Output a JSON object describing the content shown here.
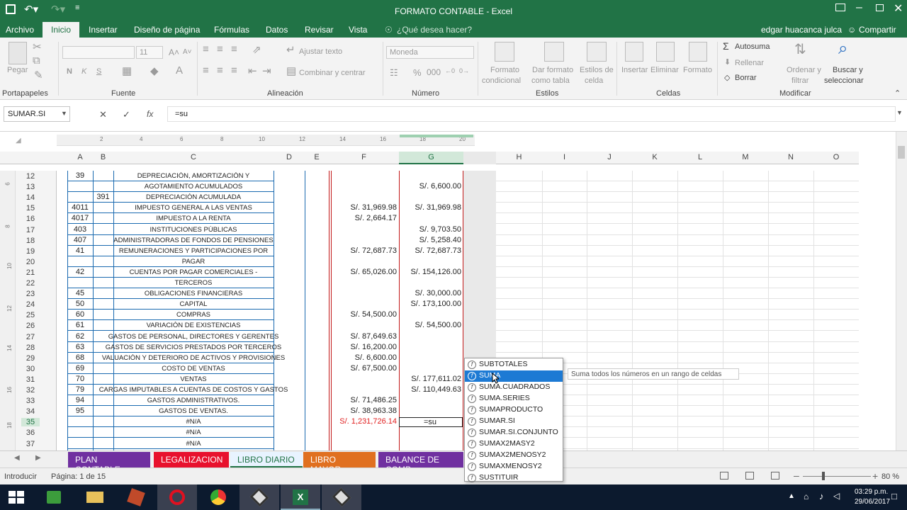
{
  "window": {
    "title": "FORMATO CONTABLE - Excel"
  },
  "menu": {
    "tabs": [
      "Archivo",
      "Inicio",
      "Insertar",
      "Diseño de página",
      "Fórmulas",
      "Datos",
      "Revisar",
      "Vista"
    ],
    "search": "¿Qué desea hacer?",
    "user": "edgar huacanca julca",
    "share": "Compartir"
  },
  "ribbon": {
    "clipboard": {
      "paste": "Pegar",
      "group": "Portapapeles"
    },
    "font": {
      "group": "Fuente",
      "size": "11",
      "bold": "N",
      "italic": "K",
      "underline": "S"
    },
    "align": {
      "wrap": "Ajustar texto",
      "merge": "Combinar y centrar",
      "group": "Alineación"
    },
    "number": {
      "format": "Moneda",
      "group": "Número"
    },
    "styles": {
      "cond1": "Formato",
      "cond2": "condicional",
      "table1": "Dar formato",
      "table2": "como tabla",
      "cell1": "Estilos de",
      "cell2": "celda",
      "group": "Estilos"
    },
    "cells": {
      "insert": "Insertar",
      "delete": "Eliminar",
      "format": "Formato",
      "group": "Celdas"
    },
    "edit": {
      "autosum": "Autosuma",
      "fill": "Rellenar",
      "clear": "Borrar",
      "sort1": "Ordenar y",
      "sort2": "filtrar",
      "find1": "Buscar y",
      "find2": "seleccionar",
      "group": "Modificar"
    }
  },
  "formula": {
    "namebox": "SUMAR.SI",
    "value": "=su"
  },
  "ruler": [
    "2",
    "4",
    "6",
    "8",
    "10",
    "12",
    "14",
    "16",
    "18",
    "20"
  ],
  "vruler": [
    "6",
    "8",
    "10",
    "12",
    "14",
    "16",
    "18"
  ],
  "columns": [
    "A",
    "B",
    "C",
    "D",
    "E",
    "F",
    "G",
    "H",
    "I",
    "J",
    "K",
    "L",
    "M",
    "N",
    "O"
  ],
  "rows": [
    {
      "n": "12",
      "a": "39",
      "b": "",
      "c": "DEPRECIACIÓN, AMORTIZACIÓN Y",
      "f": "",
      "g": ""
    },
    {
      "n": "13",
      "a": "",
      "b": "",
      "c": "AGOTAMIENTO ACUMULADOS",
      "f": "",
      "g": "S/. 6,600.00"
    },
    {
      "n": "14",
      "a": "",
      "b": "391",
      "c": "DEPRECIACIÓN ACUMULADA",
      "f": "",
      "g": ""
    },
    {
      "n": "15",
      "a": "4011",
      "b": "",
      "c": "IMPUESTO GENERAL A LAS VENTAS",
      "f": "S/. 31,969.98",
      "g": "S/. 31,969.98"
    },
    {
      "n": "16",
      "a": "4017",
      "b": "",
      "c": "IMPUESTO A LA RENTA",
      "f": "S/. 2,664.17",
      "g": ""
    },
    {
      "n": "17",
      "a": "403",
      "b": "",
      "c": "INSTITUCIONES PÚBLICAS",
      "f": "",
      "g": "S/. 9,703.50"
    },
    {
      "n": "18",
      "a": "407",
      "b": "",
      "c": "ADMINISTRADORAS DE FONDOS DE PENSIONES",
      "f": "",
      "g": "S/. 5,258.40"
    },
    {
      "n": "19",
      "a": "41",
      "b": "",
      "c": "REMUNERACIONES Y PARTICIPACIONES POR",
      "f": "S/. 72,687.73",
      "g": "S/. 72,687.73"
    },
    {
      "n": "20",
      "a": "",
      "b": "",
      "c": "PAGAR",
      "f": "",
      "g": ""
    },
    {
      "n": "21",
      "a": "42",
      "b": "",
      "c": "CUENTAS POR PAGAR COMERCIALES -",
      "f": "S/. 65,026.00",
      "g": "S/. 154,126.00"
    },
    {
      "n": "22",
      "a": "",
      "b": "",
      "c": "TERCEROS",
      "f": "",
      "g": ""
    },
    {
      "n": "23",
      "a": "45",
      "b": "",
      "c": "OBLIGACIONES FINANCIERAS",
      "f": "",
      "g": "S/. 30,000.00"
    },
    {
      "n": "24",
      "a": "50",
      "b": "",
      "c": "CAPITAL",
      "f": "",
      "g": "S/. 173,100.00"
    },
    {
      "n": "25",
      "a": "60",
      "b": "",
      "c": "COMPRAS",
      "f": "S/. 54,500.00",
      "g": ""
    },
    {
      "n": "26",
      "a": "61",
      "b": "",
      "c": "VARIACIÓN DE EXISTENCIAS",
      "f": "",
      "g": "S/. 54,500.00"
    },
    {
      "n": "27",
      "a": "62",
      "b": "",
      "c": "GASTOS DE PERSONAL, DIRECTORES Y GERENTES",
      "f": "S/. 87,649.63",
      "g": ""
    },
    {
      "n": "28",
      "a": "63",
      "b": "",
      "c": "GASTOS DE SERVICIOS PRESTADOS POR TERCEROS",
      "f": "S/. 16,200.00",
      "g": ""
    },
    {
      "n": "29",
      "a": "68",
      "b": "",
      "c": "VALUACIÓN Y DETERIORO DE ACTIVOS Y PROVISIONES",
      "f": "S/. 6,600.00",
      "g": ""
    },
    {
      "n": "30",
      "a": "69",
      "b": "",
      "c": "COSTO DE VENTAS",
      "f": "S/. 67,500.00",
      "g": ""
    },
    {
      "n": "31",
      "a": "70",
      "b": "",
      "c": "VENTAS",
      "f": "",
      "g": "S/. 177,611.02"
    },
    {
      "n": "32",
      "a": "79",
      "b": "",
      "c": "CARGAS IMPUTABLES A CUENTAS DE COSTOS Y GASTOS",
      "f": "",
      "g": "S/. 110,449.63"
    },
    {
      "n": "33",
      "a": "94",
      "b": "",
      "c": "GASTOS ADMINISTRATIVOS.",
      "f": "S/. 71,486.25",
      "g": ""
    },
    {
      "n": "34",
      "a": "95",
      "b": "",
      "c": "GASTOS DE VENTAS.",
      "f": "S/. 38,963.38",
      "g": ""
    },
    {
      "n": "35",
      "a": "",
      "b": "",
      "c": "#N/A",
      "f": "S/. 1,231,726.14",
      "g": "=su"
    },
    {
      "n": "36",
      "a": "",
      "b": "",
      "c": "#N/A",
      "f": "",
      "g": ""
    },
    {
      "n": "37",
      "a": "",
      "b": "",
      "c": "#N/A",
      "f": "",
      "g": ""
    }
  ],
  "sheets": [
    "PLAN CONTABLE",
    "LEGALIZACION",
    "LIBRO DIARIO",
    "LIBRO MAYOR",
    "BALANCE DE COMP"
  ],
  "sheet_colors": [
    "#7030a0",
    "#e8112d",
    "#e8f3ff",
    "#e07020",
    "#7030a0"
  ],
  "status": {
    "mode": "Introducir",
    "page": "Página: 1 de 15",
    "zoom": "80 %"
  },
  "autocomplete": {
    "items": [
      "SUBTOTALES",
      "SUMA",
      "SUMA.CUADRADOS",
      "SUMA.SERIES",
      "SUMAPRODUCTO",
      "SUMAR.SI",
      "SUMAR.SI.CONJUNTO",
      "SUMAX2MASY2",
      "SUMAX2MENOSY2",
      "SUMAXMENOSY2",
      "SUSTITUIR"
    ],
    "selected": 1,
    "tooltip": "Suma todos los números en un rango de celdas"
  },
  "taskbar": {
    "time": "03:29 p.m.",
    "date": "29/06/2017"
  }
}
